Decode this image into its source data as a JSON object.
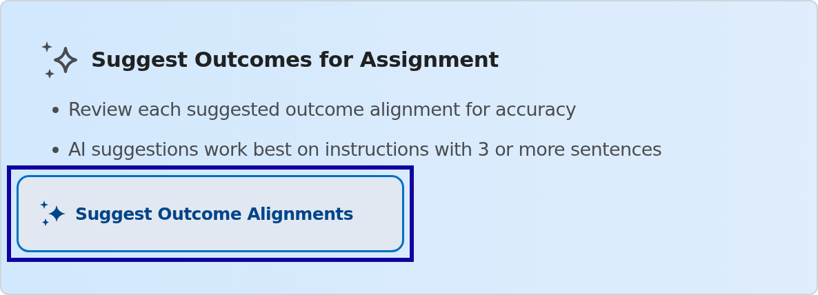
{
  "title": "Suggest Outcomes for Assignment",
  "tips": [
    "Review each suggested outcome alignment for accuracy",
    "AI suggestions work best on instructions with 3 or more sentences"
  ],
  "button": {
    "label": "Suggest Outcome Alignments",
    "focused": true
  }
}
